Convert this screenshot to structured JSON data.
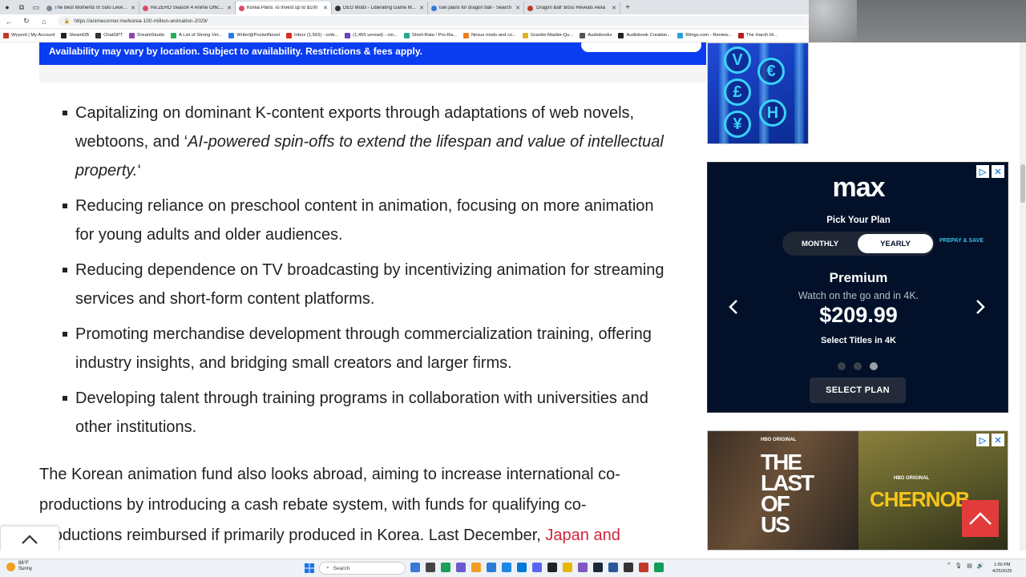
{
  "browser": {
    "tabs": [
      {
        "title": "The Best Moments In Solo Leveling",
        "color": "#7a8a9a",
        "active": false
      },
      {
        "title": "Re:ZERO Season 4 Anime Officially",
        "color": "#e04a6a",
        "active": false
      },
      {
        "title": "Korea Plans To Invest up to $100",
        "color": "#e04a6a",
        "active": true
      },
      {
        "title": "DEG Mods - Liberating Game Mods",
        "color": "#333333",
        "active": false
      },
      {
        "title": "toei plans for dragon ball - Search",
        "color": "#3a78d8",
        "active": false
      },
      {
        "title": "'Dragon Ball' Boss Reveals Akira",
        "color": "#c0392b",
        "active": false
      }
    ],
    "url": "https://animecorner.me/korea-100-million-animation-2029/",
    "bookmarks": [
      {
        "label": "Wyyerd | My Account",
        "color": "#c0392b"
      },
      {
        "label": "SteamDB",
        "color": "#222222"
      },
      {
        "label": "ChatGPT",
        "color": "#333333"
      },
      {
        "label": "DreamStudio",
        "color": "#8e44ad"
      },
      {
        "label": "A List of Strong Ver...",
        "color": "#27ae60"
      },
      {
        "label": "Writer@PocketNovel",
        "color": "#2c7be5"
      },
      {
        "label": "Inbox (1,563) - cmb...",
        "color": "#d93025"
      },
      {
        "label": "(1,455 unread) - cm...",
        "color": "#6f42c1"
      },
      {
        "label": "Short-Rate / Pro-Ra...",
        "color": "#2ca58d"
      },
      {
        "label": "Nexus mods and co...",
        "color": "#e67e22"
      },
      {
        "label": "Granite-Marble-Qu...",
        "color": "#e1b12c"
      },
      {
        "label": "Audiobooks",
        "color": "#555555"
      },
      {
        "label": "Audiobook Creation...",
        "color": "#222222"
      },
      {
        "label": "Rtings.com - Review...",
        "color": "#2d9cdb"
      },
      {
        "label": "The Harsh Hi...",
        "color": "#b71c1c"
      }
    ]
  },
  "promo": {
    "text": "Availability may vary by location. Subject to availability. Restrictions & fees apply."
  },
  "article": {
    "bullets": [
      {
        "plain": "Capitalizing on dominant K-content exports through adaptations of web novels, webtoons, and ‘",
        "italic": "AI-powered spin-offs to extend the lifespan and value of intellectual property.",
        "tail": "‘"
      },
      {
        "plain": "Reducing reliance on preschool content in animation, focusing on more animation for young adults and older audiences.",
        "italic": "",
        "tail": ""
      },
      {
        "plain": "Reducing dependence on TV broadcasting by incentivizing animation for streaming services and short-form content platforms.",
        "italic": "",
        "tail": ""
      },
      {
        "plain": "Promoting merchandise development through commercialization training, offering industry insights, and bridging small creators and larger firms.",
        "italic": "",
        "tail": ""
      },
      {
        "plain": "Developing talent through training programs in collaboration with universities and other institutions.",
        "italic": "",
        "tail": ""
      }
    ],
    "paragraph": "The Korean animation fund also looks abroad, aiming to increase international co-productions by introducing a cash rebate system, with funds for qualifying co-productions reimbursed if primarily produced in Korea. Last December, ",
    "paragraph_link": "Japan and"
  },
  "max_ad": {
    "logo": "max",
    "pick_label": "Pick Your Plan",
    "monthly_label": "MONTHLY",
    "yearly_label": "YEARLY",
    "prepay_label": "PREPAY & SAVE",
    "plan_name": "Premium",
    "plan_desc": "Watch on the go and in 4K.",
    "price": "$209.99",
    "titles_note": "Select Titles in 4K",
    "cta": "SELECT PLAN",
    "dots_total": 3,
    "active_dot": 3
  },
  "hbo_ad": {
    "badge_left": "HBO ORIGINAL",
    "title_left": "THE LAST OF US",
    "badge_right": "HBO ORIGINAL",
    "title_right": "CHERNOB"
  },
  "currency_ad": {
    "symbols": [
      "V",
      "€",
      "£",
      "H",
      "¥"
    ]
  },
  "taskbar": {
    "temperature": "88°F",
    "condition": "Sunny",
    "search_placeholder": "Search",
    "time": "1:50 PM",
    "date": "4/25/2025",
    "app_colors": [
      "#3a78d8",
      "#444444",
      "#1a9e5a",
      "#6a5acd",
      "#f0a020",
      "#2b7cd3",
      "#1e88e5",
      "#0078d4",
      "#5865f2",
      "#222222",
      "#e6b800",
      "#7e57c2",
      "#1b2838",
      "#2b579a",
      "#333333",
      "#c0392b",
      "#0f9d58"
    ]
  }
}
